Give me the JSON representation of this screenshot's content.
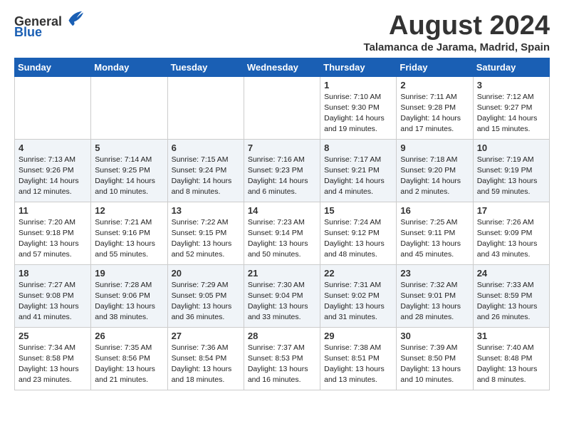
{
  "logo": {
    "general": "General",
    "blue": "Blue"
  },
  "title": "August 2024",
  "subtitle": "Talamanca de Jarama, Madrid, Spain",
  "days_header": [
    "Sunday",
    "Monday",
    "Tuesday",
    "Wednesday",
    "Thursday",
    "Friday",
    "Saturday"
  ],
  "weeks": [
    [
      {
        "day": "",
        "content": ""
      },
      {
        "day": "",
        "content": ""
      },
      {
        "day": "",
        "content": ""
      },
      {
        "day": "",
        "content": ""
      },
      {
        "day": "1",
        "content": "Sunrise: 7:10 AM\nSunset: 9:30 PM\nDaylight: 14 hours\nand 19 minutes."
      },
      {
        "day": "2",
        "content": "Sunrise: 7:11 AM\nSunset: 9:28 PM\nDaylight: 14 hours\nand 17 minutes."
      },
      {
        "day": "3",
        "content": "Sunrise: 7:12 AM\nSunset: 9:27 PM\nDaylight: 14 hours\nand 15 minutes."
      }
    ],
    [
      {
        "day": "4",
        "content": "Sunrise: 7:13 AM\nSunset: 9:26 PM\nDaylight: 14 hours\nand 12 minutes."
      },
      {
        "day": "5",
        "content": "Sunrise: 7:14 AM\nSunset: 9:25 PM\nDaylight: 14 hours\nand 10 minutes."
      },
      {
        "day": "6",
        "content": "Sunrise: 7:15 AM\nSunset: 9:24 PM\nDaylight: 14 hours\nand 8 minutes."
      },
      {
        "day": "7",
        "content": "Sunrise: 7:16 AM\nSunset: 9:23 PM\nDaylight: 14 hours\nand 6 minutes."
      },
      {
        "day": "8",
        "content": "Sunrise: 7:17 AM\nSunset: 9:21 PM\nDaylight: 14 hours\nand 4 minutes."
      },
      {
        "day": "9",
        "content": "Sunrise: 7:18 AM\nSunset: 9:20 PM\nDaylight: 14 hours\nand 2 minutes."
      },
      {
        "day": "10",
        "content": "Sunrise: 7:19 AM\nSunset: 9:19 PM\nDaylight: 13 hours\nand 59 minutes."
      }
    ],
    [
      {
        "day": "11",
        "content": "Sunrise: 7:20 AM\nSunset: 9:18 PM\nDaylight: 13 hours\nand 57 minutes."
      },
      {
        "day": "12",
        "content": "Sunrise: 7:21 AM\nSunset: 9:16 PM\nDaylight: 13 hours\nand 55 minutes."
      },
      {
        "day": "13",
        "content": "Sunrise: 7:22 AM\nSunset: 9:15 PM\nDaylight: 13 hours\nand 52 minutes."
      },
      {
        "day": "14",
        "content": "Sunrise: 7:23 AM\nSunset: 9:14 PM\nDaylight: 13 hours\nand 50 minutes."
      },
      {
        "day": "15",
        "content": "Sunrise: 7:24 AM\nSunset: 9:12 PM\nDaylight: 13 hours\nand 48 minutes."
      },
      {
        "day": "16",
        "content": "Sunrise: 7:25 AM\nSunset: 9:11 PM\nDaylight: 13 hours\nand 45 minutes."
      },
      {
        "day": "17",
        "content": "Sunrise: 7:26 AM\nSunset: 9:09 PM\nDaylight: 13 hours\nand 43 minutes."
      }
    ],
    [
      {
        "day": "18",
        "content": "Sunrise: 7:27 AM\nSunset: 9:08 PM\nDaylight: 13 hours\nand 41 minutes."
      },
      {
        "day": "19",
        "content": "Sunrise: 7:28 AM\nSunset: 9:06 PM\nDaylight: 13 hours\nand 38 minutes."
      },
      {
        "day": "20",
        "content": "Sunrise: 7:29 AM\nSunset: 9:05 PM\nDaylight: 13 hours\nand 36 minutes."
      },
      {
        "day": "21",
        "content": "Sunrise: 7:30 AM\nSunset: 9:04 PM\nDaylight: 13 hours\nand 33 minutes."
      },
      {
        "day": "22",
        "content": "Sunrise: 7:31 AM\nSunset: 9:02 PM\nDaylight: 13 hours\nand 31 minutes."
      },
      {
        "day": "23",
        "content": "Sunrise: 7:32 AM\nSunset: 9:01 PM\nDaylight: 13 hours\nand 28 minutes."
      },
      {
        "day": "24",
        "content": "Sunrise: 7:33 AM\nSunset: 8:59 PM\nDaylight: 13 hours\nand 26 minutes."
      }
    ],
    [
      {
        "day": "25",
        "content": "Sunrise: 7:34 AM\nSunset: 8:58 PM\nDaylight: 13 hours\nand 23 minutes."
      },
      {
        "day": "26",
        "content": "Sunrise: 7:35 AM\nSunset: 8:56 PM\nDaylight: 13 hours\nand 21 minutes."
      },
      {
        "day": "27",
        "content": "Sunrise: 7:36 AM\nSunset: 8:54 PM\nDaylight: 13 hours\nand 18 minutes."
      },
      {
        "day": "28",
        "content": "Sunrise: 7:37 AM\nSunset: 8:53 PM\nDaylight: 13 hours\nand 16 minutes."
      },
      {
        "day": "29",
        "content": "Sunrise: 7:38 AM\nSunset: 8:51 PM\nDaylight: 13 hours\nand 13 minutes."
      },
      {
        "day": "30",
        "content": "Sunrise: 7:39 AM\nSunset: 8:50 PM\nDaylight: 13 hours\nand 10 minutes."
      },
      {
        "day": "31",
        "content": "Sunrise: 7:40 AM\nSunset: 8:48 PM\nDaylight: 13 hours\nand 8 minutes."
      }
    ]
  ]
}
